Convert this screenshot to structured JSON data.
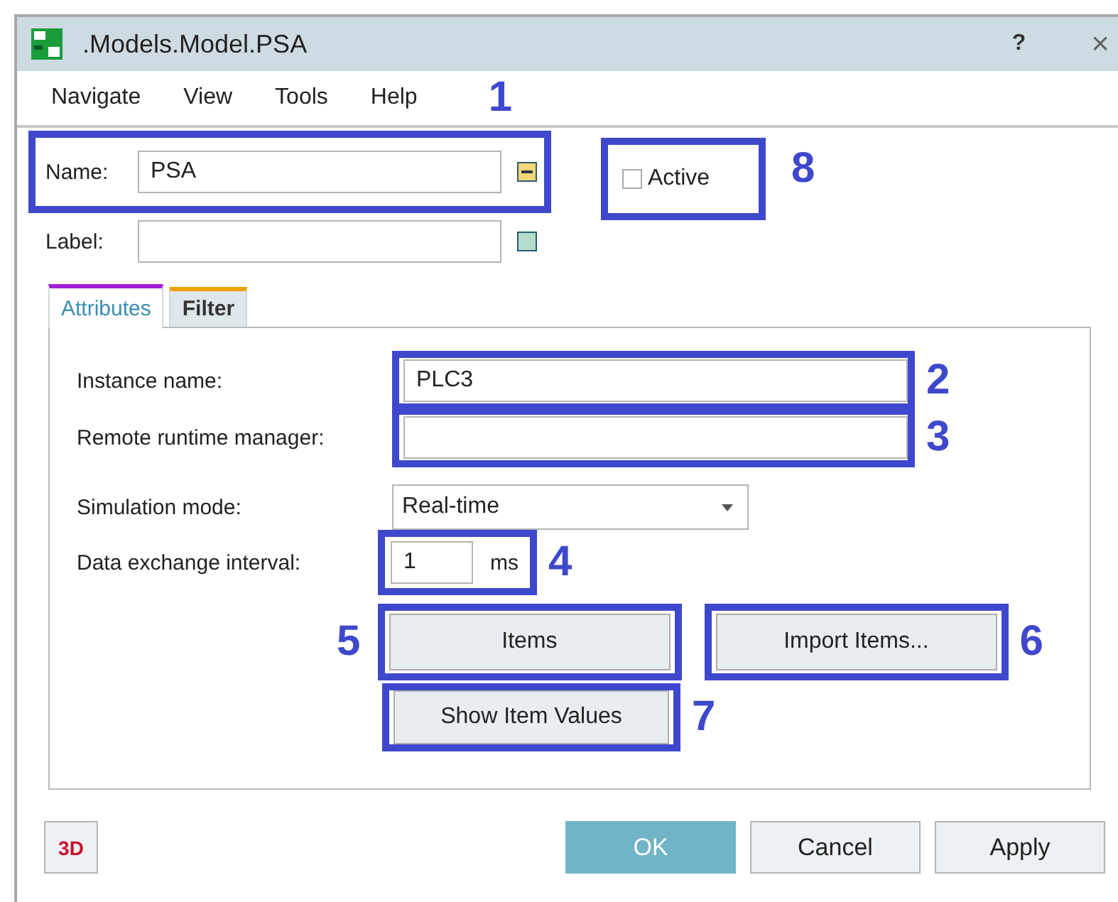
{
  "window": {
    "title": ".Models.Model.PSA",
    "buttons": [
      "?",
      "×"
    ]
  },
  "menu": [
    {
      "label": "Navigate"
    },
    {
      "label": "View"
    },
    {
      "label": "Tools"
    },
    {
      "label": "Help"
    }
  ],
  "menu_callout": "1",
  "name": {
    "label": "Name:",
    "value": "PSA"
  },
  "label_field": {
    "label": "Label:"
  },
  "active": {
    "label": "Active",
    "checked": false,
    "callout": "8"
  },
  "tabs": [
    {
      "label": "Attributes",
      "selected": true,
      "color": "#a21fd6"
    },
    {
      "label": "Filter",
      "selected": false,
      "color": "#f5a000"
    }
  ],
  "attributes": {
    "instance_name": {
      "label": "Instance name:",
      "value": "PLC3",
      "callout": "2"
    },
    "remote_runtime_manager": {
      "label": "Remote runtime manager:",
      "callout": "3"
    },
    "simulation_mode": {
      "label": "Simulation mode:",
      "value": "Real-time"
    },
    "data_exchange_interval": {
      "label": "Data exchange interval:",
      "value": "1",
      "unit": "ms",
      "callout": "4"
    },
    "buttons": [
      {
        "label": "Items",
        "callout": "5"
      },
      {
        "label": "Import Items...",
        "callout": "6"
      },
      {
        "label": "Show Item Values",
        "callout": "7"
      }
    ]
  },
  "footer": {
    "view_3d": "3D",
    "buttons": [
      {
        "label": "OK",
        "primary": true
      },
      {
        "label": "Cancel",
        "primary": false
      },
      {
        "label": "Apply",
        "primary": false
      }
    ]
  }
}
